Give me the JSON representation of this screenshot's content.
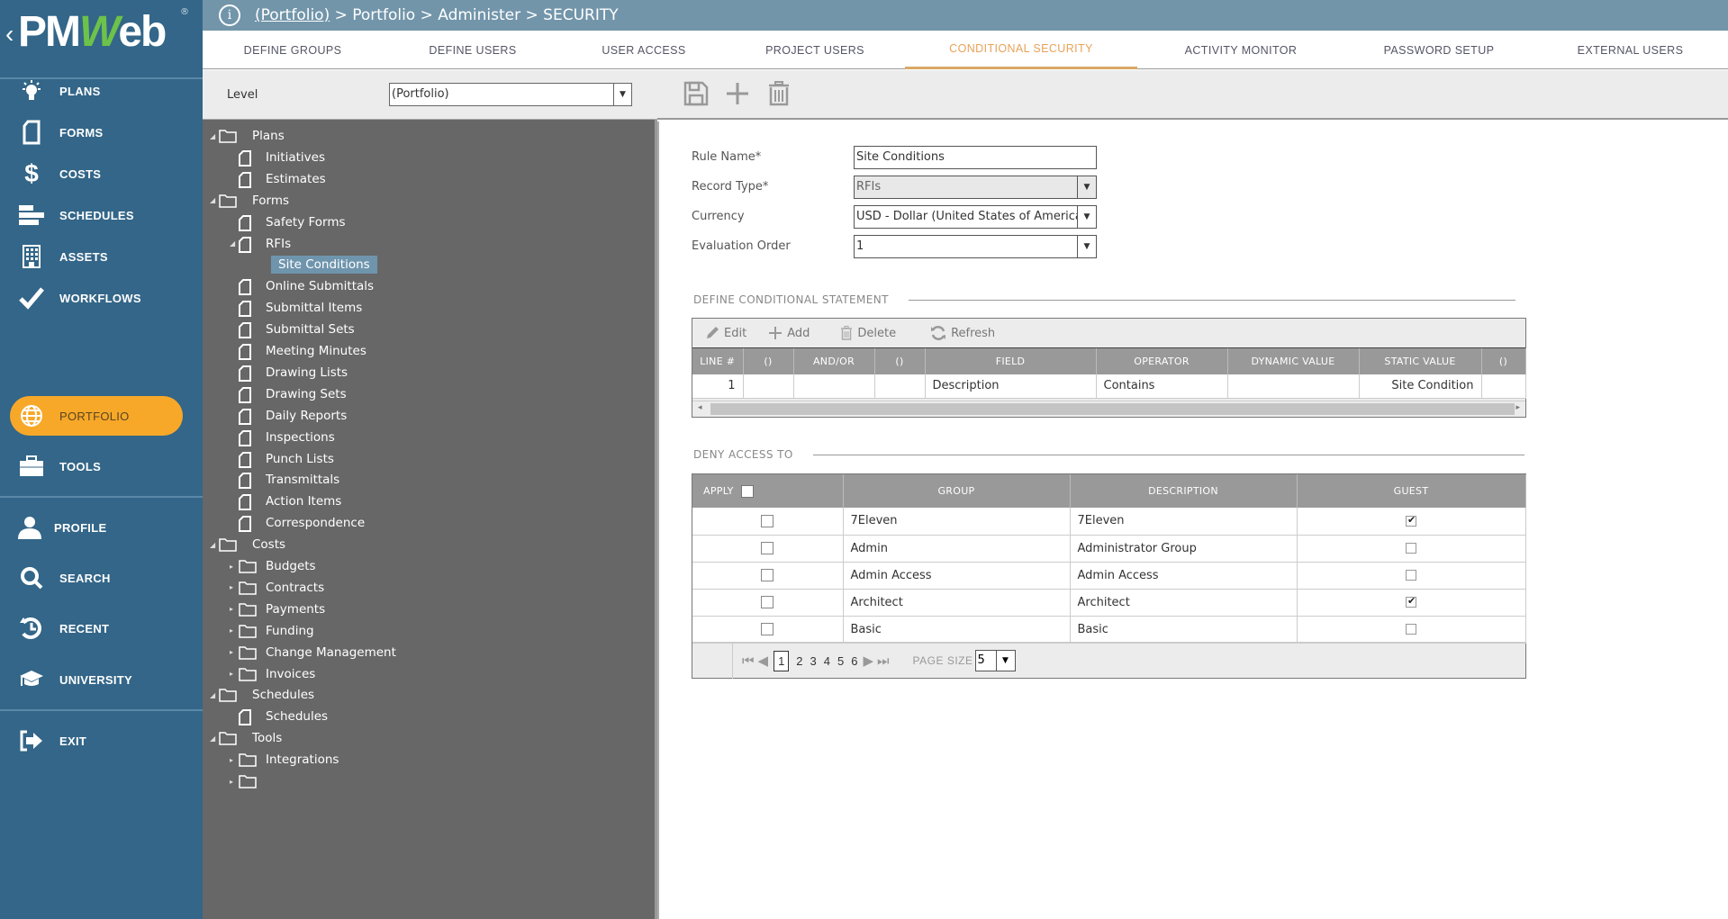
{
  "app": {
    "logo_text_prefix": "PM",
    "logo_text_w": "W",
    "logo_text_suffix": "eb",
    "logo_reg": "®",
    "logo_back": "‹"
  },
  "sidebar": {
    "items": [
      {
        "label": "PLANS",
        "icon": "lightbulb-icon"
      },
      {
        "label": "FORMS",
        "icon": "document-icon"
      },
      {
        "label": "COSTS",
        "icon": "dollar-icon"
      },
      {
        "label": "SCHEDULES",
        "icon": "gantt-bars-icon"
      },
      {
        "label": "ASSETS",
        "icon": "building-icon"
      },
      {
        "label": "WORKFLOWS",
        "icon": "checkmark-icon"
      },
      {
        "label": "PORTFOLIO",
        "icon": "globe-icon",
        "active": true
      },
      {
        "label": "TOOLS",
        "icon": "toolbox-icon"
      },
      {
        "label": "PROFILE",
        "icon": "user-icon"
      },
      {
        "label": "SEARCH",
        "icon": "search-icon"
      },
      {
        "label": "RECENT",
        "icon": "history-icon"
      },
      {
        "label": "UNIVERSITY",
        "icon": "graduation-cap-icon"
      },
      {
        "label": "EXIT",
        "icon": "exit-icon"
      }
    ],
    "accent_color": "#f7a829",
    "background_color": "#336688"
  },
  "breadcrumb": {
    "info_icon": "i",
    "root_link": "(Portfolio)",
    "rest": " > Portfolio > Administer > SECURITY"
  },
  "tabs": [
    {
      "label": "DEFINE GROUPS"
    },
    {
      "label": "DEFINE USERS"
    },
    {
      "label": "USER ACCESS"
    },
    {
      "label": "PROJECT USERS"
    },
    {
      "label": "CONDITIONAL SECURITY",
      "active": true
    },
    {
      "label": "ACTIVITY MONITOR"
    },
    {
      "label": "PASSWORD SETUP"
    },
    {
      "label": "EXTERNAL USERS"
    }
  ],
  "level": {
    "label": "Level",
    "value": "(Portfolio)",
    "arrow": "▼"
  },
  "tree": [
    {
      "label": "Plans",
      "type": "folder",
      "depth": 0,
      "toggle": "◢"
    },
    {
      "label": "Initiatives",
      "type": "doc",
      "depth": 1
    },
    {
      "label": "Estimates",
      "type": "doc",
      "depth": 1
    },
    {
      "label": "Forms",
      "type": "folder",
      "depth": 0,
      "toggle": "◢"
    },
    {
      "label": "Safety Forms",
      "type": "doc",
      "depth": 1
    },
    {
      "label": "RFIs",
      "type": "doc",
      "depth": 1,
      "toggle": "◢"
    },
    {
      "label": "Site Conditions",
      "type": "leaf",
      "depth": 2,
      "selected": true
    },
    {
      "label": "Online Submittals",
      "type": "doc",
      "depth": 1
    },
    {
      "label": "Submittal Items",
      "type": "doc",
      "depth": 1
    },
    {
      "label": "Submittal Sets",
      "type": "doc",
      "depth": 1
    },
    {
      "label": "Meeting Minutes",
      "type": "doc",
      "depth": 1
    },
    {
      "label": "Drawing Lists",
      "type": "doc",
      "depth": 1
    },
    {
      "label": "Drawing Sets",
      "type": "doc",
      "depth": 1
    },
    {
      "label": "Daily Reports",
      "type": "doc",
      "depth": 1
    },
    {
      "label": "Inspections",
      "type": "doc",
      "depth": 1
    },
    {
      "label": "Punch Lists",
      "type": "doc",
      "depth": 1
    },
    {
      "label": "Transmittals",
      "type": "doc",
      "depth": 1
    },
    {
      "label": "Action Items",
      "type": "doc",
      "depth": 1
    },
    {
      "label": "Correspondence",
      "type": "doc",
      "depth": 1
    },
    {
      "label": "Costs",
      "type": "folder",
      "depth": 0,
      "toggle": "◢"
    },
    {
      "label": "Budgets",
      "type": "subfolder",
      "depth": 1,
      "toggle": "▸"
    },
    {
      "label": "Contracts",
      "type": "subfolder",
      "depth": 1,
      "toggle": "▸"
    },
    {
      "label": "Payments",
      "type": "subfolder",
      "depth": 1,
      "toggle": "▸"
    },
    {
      "label": "Funding",
      "type": "subfolder",
      "depth": 1,
      "toggle": "▸"
    },
    {
      "label": "Change Management",
      "type": "subfolder",
      "depth": 1,
      "toggle": "▸"
    },
    {
      "label": "Invoices",
      "type": "subfolder",
      "depth": 1,
      "toggle": "▸"
    },
    {
      "label": "Schedules",
      "type": "folder",
      "depth": 0,
      "toggle": "◢"
    },
    {
      "label": "Schedules",
      "type": "doc",
      "depth": 1
    },
    {
      "label": "Tools",
      "type": "folder",
      "depth": 0,
      "toggle": "◢"
    },
    {
      "label": "Integrations",
      "type": "subfolder",
      "depth": 1,
      "toggle": "▸"
    },
    {
      "label": "",
      "type": "subfolder",
      "depth": 1,
      "toggle": "▸"
    }
  ],
  "toolbar": {
    "save_icon": "save-icon",
    "add_icon": "plus-icon",
    "delete_icon": "trash-icon"
  },
  "form": {
    "rule_name": {
      "label": "Rule Name*",
      "value": "Site Conditions"
    },
    "record_type": {
      "label": "Record Type*",
      "value": "RFIs",
      "disabled": true
    },
    "currency": {
      "label": "Currency",
      "value": "USD - Dollar (United States of America)"
    },
    "evaluation_order": {
      "label": "Evaluation Order",
      "value": "1"
    },
    "dropdown_arrow": "▼"
  },
  "conditional_statement": {
    "section_title": "DEFINE CONDITIONAL STATEMENT",
    "toolbar": {
      "edit": "Edit",
      "add": "Add",
      "delete": "Delete",
      "refresh": "Refresh"
    },
    "columns": [
      "LINE #",
      "()",
      "AND/OR",
      "()",
      "FIELD",
      "OPERATOR",
      "DYNAMIC VALUE",
      "STATIC VALUE",
      "()"
    ],
    "rows": [
      [
        "1",
        "",
        "",
        "",
        "Description",
        "Contains",
        "",
        "Site Condition",
        ""
      ]
    ],
    "scroll_left": "◂",
    "scroll_right": "▸"
  },
  "deny_access": {
    "section_title": "DENY ACCESS TO",
    "columns": [
      "APPLY",
      "GROUP",
      "DESCRIPTION",
      "GUEST"
    ],
    "rows": [
      {
        "apply": false,
        "group": "7Eleven",
        "description": "7Eleven",
        "guest": true
      },
      {
        "apply": false,
        "group": "Admin",
        "description": "Administrator Group",
        "guest": false
      },
      {
        "apply": false,
        "group": "Admin Access",
        "description": "Admin Access",
        "guest": false
      },
      {
        "apply": false,
        "group": "Architect",
        "description": "Architect",
        "guest": true
      },
      {
        "apply": false,
        "group": "Basic",
        "description": "Basic",
        "guest": false
      }
    ],
    "pager": {
      "first": "⏮",
      "prev": "◀",
      "pages": [
        "1",
        "2",
        "3",
        "4",
        "5",
        "6"
      ],
      "current_page": "1",
      "next": "▶",
      "last": "⏭",
      "page_size_label": "PAGE SIZE",
      "page_size": "5",
      "arrow": "▼"
    }
  }
}
